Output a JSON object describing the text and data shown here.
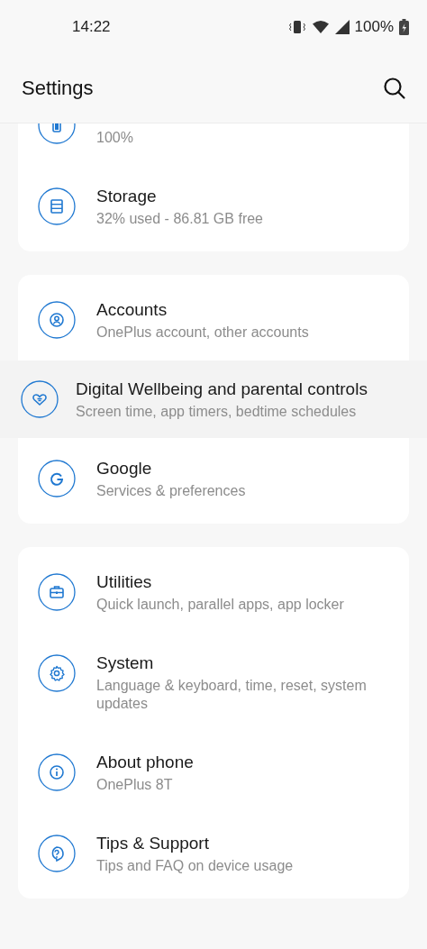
{
  "status_bar": {
    "time": "14:22",
    "battery": "100%"
  },
  "header": {
    "title": "Settings"
  },
  "sections": [
    {
      "items": [
        {
          "kind": "normal",
          "subtitle": "100%"
        },
        {
          "kind": "normal",
          "title": "Storage",
          "subtitle": "32% used - 86.81 GB free"
        }
      ]
    },
    {
      "items": [
        {
          "kind": "normal",
          "title": "Accounts",
          "subtitle": "OnePlus account, other accounts"
        },
        {
          "kind": "dragged",
          "title": "Digital Wellbeing and parental controls",
          "subtitle": "Screen time, app timers, bedtime schedules"
        },
        {
          "kind": "normal",
          "title": "Google",
          "subtitle": "Services & preferences"
        }
      ]
    },
    {
      "items": [
        {
          "kind": "normal",
          "title": "Utilities",
          "subtitle": "Quick launch, parallel apps, app locker"
        },
        {
          "kind": "normal",
          "title": "System",
          "subtitle": "Language & keyboard, time, reset, system updates"
        },
        {
          "kind": "normal",
          "title": "About phone",
          "subtitle": "OnePlus 8T"
        },
        {
          "kind": "normal",
          "title": "Tips & Support",
          "subtitle": "Tips and FAQ on device usage"
        }
      ]
    }
  ]
}
